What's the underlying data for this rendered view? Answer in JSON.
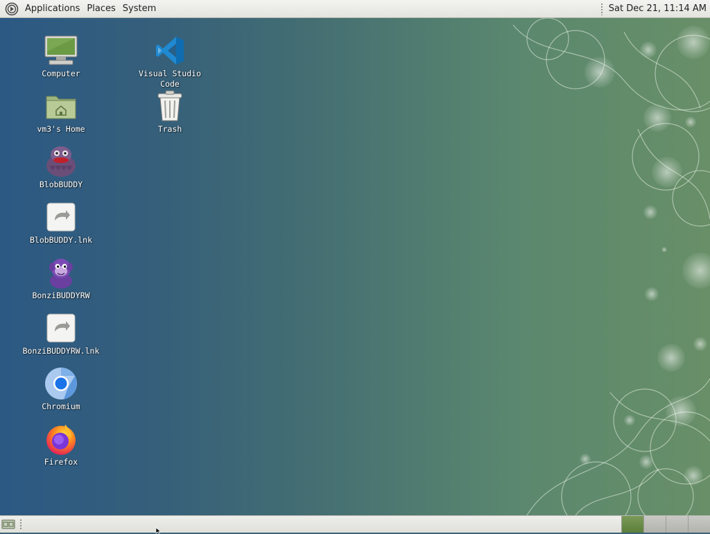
{
  "top_panel": {
    "menus": {
      "applications": "Applications",
      "places": "Places",
      "system": "System"
    },
    "clock": "Sat Dec 21, 11:14 AM"
  },
  "desktop": {
    "icons": {
      "computer": "Computer",
      "home": "vm3's Home",
      "blobbuddy": "BlobBUDDY",
      "blobbuddy_lnk": "BlobBUDDY.lnk",
      "bonzibuddyrw": "BonziBUDDYRW",
      "bonzibuddyrw_lnk": "BonziBUDDYRW.lnk",
      "chromium": "Chromium",
      "firefox": "Firefox",
      "vscode": "Visual Studio\nCode",
      "trash": "Trash"
    }
  },
  "bottom_panel": {
    "workspaces": 4,
    "active_workspace": 1
  },
  "colors": {
    "panel": "#e8e8e3",
    "wallpaper_left": "#2c5984",
    "wallpaper_right": "#688f67",
    "active_workspace": "#6a8c48"
  }
}
